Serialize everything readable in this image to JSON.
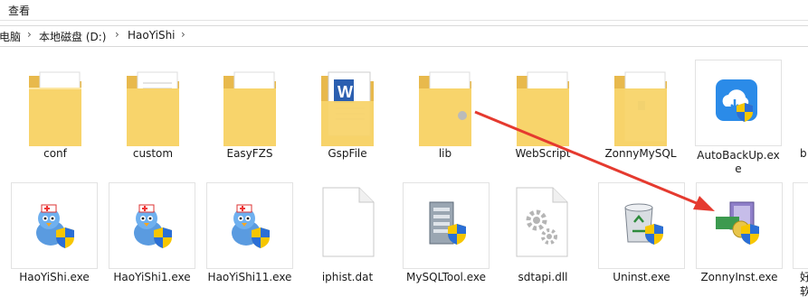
{
  "ribbon": {
    "view_tab": "查看"
  },
  "breadcrumb": [
    {
      "label": "电脑"
    },
    {
      "label": "本地磁盘 (D:)"
    },
    {
      "label": "HaoYiShi"
    }
  ],
  "row1": [
    {
      "label": "conf",
      "icon": "folder-icon"
    },
    {
      "label": "custom",
      "icon": "folder-icon"
    },
    {
      "label": "EasyFZS",
      "icon": "folder-icon"
    },
    {
      "label": "GspFile",
      "icon": "folder-with-document-icon"
    },
    {
      "label": "lib",
      "icon": "folder-icon"
    },
    {
      "label": "WebScript",
      "icon": "folder-icon"
    },
    {
      "label": "ZonnyMySQL",
      "icon": "folder-icon"
    },
    {
      "label": "AutoBackUp.exe",
      "icon": "cloud-backup-app-icon"
    },
    {
      "label": "b",
      "icon": "partial-item"
    }
  ],
  "row2": [
    {
      "label": "HaoYiShi.exe",
      "icon": "bird-doctor-app-icon"
    },
    {
      "label": "HaoYiShi1.exe",
      "icon": "bird-doctor-app-icon"
    },
    {
      "label": "HaoYiShi11.exe",
      "icon": "bird-doctor-app-icon"
    },
    {
      "label": "iphist.dat",
      "icon": "blank-file-icon"
    },
    {
      "label": "MySQLTool.exe",
      "icon": "server-app-icon"
    },
    {
      "label": "sdtapi.dll",
      "icon": "gear-file-icon"
    },
    {
      "label": "Uninst.exe",
      "icon": "recycle-bin-icon"
    },
    {
      "label": "ZonnyInst.exe",
      "icon": "installer-app-icon"
    },
    {
      "label": "好",
      "label2": "软",
      "icon": "partial-item"
    }
  ],
  "colors": {
    "arrow": "#e53a2f",
    "folder": "#f8d46b",
    "shield_blue": "#2b6fd6",
    "shield_yellow": "#f7c600"
  }
}
